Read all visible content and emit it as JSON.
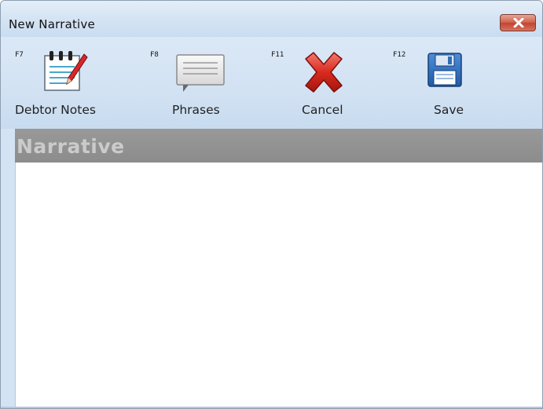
{
  "window": {
    "title": "New Narrative"
  },
  "toolbar": {
    "buttons": [
      {
        "fkey": "F7",
        "label": "Debtor Notes",
        "icon": "notepad-pencil-icon"
      },
      {
        "fkey": "F8",
        "label": "Phrases",
        "icon": "speech-bubble-icon"
      },
      {
        "fkey": "F11",
        "label": "Cancel",
        "icon": "red-x-icon"
      },
      {
        "fkey": "F12",
        "label": "Save",
        "icon": "floppy-disk-icon"
      }
    ]
  },
  "narrative": {
    "header": "Narrative",
    "text": ""
  },
  "colors": {
    "titlebar": "#d6e5f4",
    "toolbar": "#d2e2f3",
    "section_header": "#8f8f8f",
    "section_header_text": "#cbcbcb",
    "close_button": "#c94f3b"
  }
}
